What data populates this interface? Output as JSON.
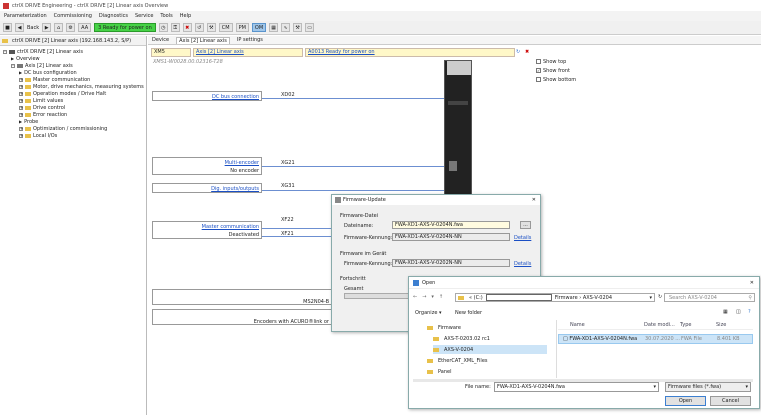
{
  "window": {
    "title": "ctrlX DRIVE Engineering - ctrlX DRIVE [2] Linear axis Overview"
  },
  "menu": [
    "Parameterization",
    "Commissioning",
    "Diagnostics",
    "Service",
    "Tools",
    "Help"
  ],
  "toolbar": {
    "back": "Back",
    "axis_badge": "AA",
    "status": "3 Ready for power on",
    "cm": "CM",
    "pm": "PM",
    "om": "OM"
  },
  "tree": {
    "device": "ctrlX DRIVE [2] Linear axis (192.168.143.2, S/P)",
    "items": [
      {
        "label": "ctrlX DRIVE [2] Linear axis",
        "lvl": 0,
        "kind": "drive"
      },
      {
        "label": "Overview",
        "lvl": 1,
        "kind": "tri"
      },
      {
        "label": "Axis [2] Linear axis",
        "lvl": 1,
        "kind": "axis"
      },
      {
        "label": "DC bus configuration",
        "lvl": 2,
        "kind": "tri"
      },
      {
        "label": "Master communication",
        "lvl": 2,
        "kind": "fold"
      },
      {
        "label": "Motor, drive mechanics, measuring systems",
        "lvl": 2,
        "kind": "fold"
      },
      {
        "label": "Operation modes / Drive Halt",
        "lvl": 2,
        "kind": "fold"
      },
      {
        "label": "Limit values",
        "lvl": 2,
        "kind": "fold"
      },
      {
        "label": "Drive control",
        "lvl": 2,
        "kind": "fold"
      },
      {
        "label": "Error reaction",
        "lvl": 2,
        "kind": "fold"
      },
      {
        "label": "Probe",
        "lvl": 2,
        "kind": "tri"
      },
      {
        "label": "Optimization / commissioning",
        "lvl": 2,
        "kind": "fold"
      },
      {
        "label": "Local I/Os",
        "lvl": 2,
        "kind": "fold"
      }
    ]
  },
  "tabs": [
    "Device",
    "Axis [2] Linear axis",
    "IP settings"
  ],
  "header": {
    "device": "XM5",
    "axis": "Axis [2] Linear axis",
    "status": "A0013 Ready for power on",
    "serial": "XMS1-W0028.00.02316-T28"
  },
  "connectors": {
    "dc_bus": "DC bus connection",
    "x_dc": "XD02",
    "multi_encoder": "Multi-encoder",
    "no_encoder": "No encoder",
    "xg21": "XG21",
    "dig_io": "Dig. inputs/outputs",
    "xg31": "XG31",
    "master_comm": "Master communication",
    "deactivated": "Deactivated",
    "xf22": "XF22",
    "xf21": "XF21",
    "ms": "MS2N04-B",
    "encoders": "Encoders with ACURO®link or"
  },
  "view_opts": {
    "show_top": "Show top",
    "show_front": "Show front",
    "show_bottom": "Show bottom",
    "top_checked": false,
    "front_checked": true,
    "bottom_checked": false
  },
  "fw_dialog": {
    "title": "Firmware-Update",
    "file_section": "Firmware-Datei",
    "filename_label": "Dateiname:",
    "filename": "FWA-XD1-AXS-V-0204N.fwa",
    "browse": "...",
    "id_label": "Firmware-Kennung:",
    "file_id": "FWA-XD1-AXS-V-0204N-NN",
    "details": "Details",
    "device_section": "Firmware im Gerät",
    "device_id": "FWA-XD1-AXS-V-0202N-NN",
    "progress": "Fortschritt",
    "total": "Gesamt"
  },
  "open_dialog": {
    "title": "Open",
    "path_prefix": "« (C:)",
    "path_tail": "Firmware › AXS-V-0204",
    "search_placeholder": "Search AXS-V-0204",
    "organize": "Organize ▾",
    "new_folder": "New folder",
    "nav": [
      {
        "label": "Firmware",
        "indent": 0,
        "selected": false
      },
      {
        "label": "AXS-T-0203.02 rc1",
        "indent": 1,
        "selected": false
      },
      {
        "label": "AXS-V-0204",
        "indent": 1,
        "selected": true
      },
      {
        "label": "EtherCAT_XML_Files",
        "indent": 0,
        "selected": false
      },
      {
        "label": "Panel",
        "indent": 0,
        "selected": false
      }
    ],
    "columns": [
      "Name",
      "Date modi...",
      "Type",
      "Size"
    ],
    "file": {
      "name": "FWA-XD1-AXS-V-0204N.fwa",
      "date": "30.07.2020 ...",
      "type": "FWA File",
      "size": "8.401 KB"
    },
    "filename_label": "File name:",
    "filename_value": "FWA-XD1-AXS-V-0204N.fwa",
    "filter": "Firmware files (*.fwa)",
    "open": "Open",
    "cancel": "Cancel"
  }
}
